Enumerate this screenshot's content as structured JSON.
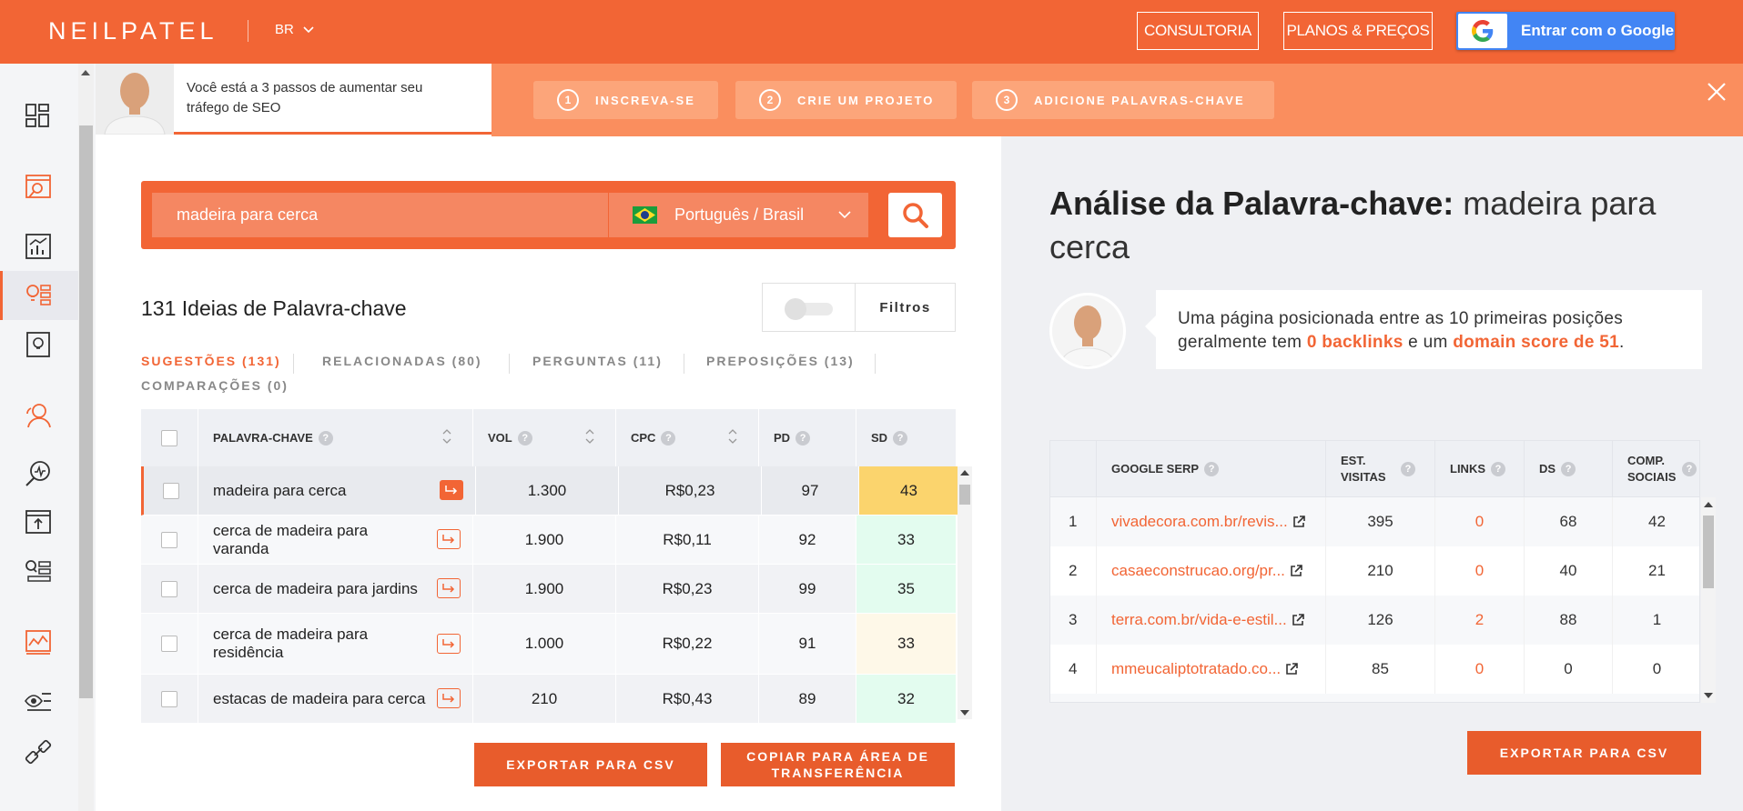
{
  "topbar": {
    "logo": "NEILPATEL",
    "lang": "BR",
    "consult_label": "CONSULTORIA",
    "planos_label": "PLANOS & PREÇOS",
    "google_label": "Entrar com o Google"
  },
  "banner": {
    "text": "Você está a 3 passos de aumentar seu tráfego de SEO",
    "steps": [
      {
        "num": "1",
        "label": "INSCREVA-SE"
      },
      {
        "num": "2",
        "label": "CRIE UM PROJETO"
      },
      {
        "num": "3",
        "label": "ADICIONE PALAVRAS-CHAVE"
      }
    ]
  },
  "search": {
    "value": "madeira para cerca",
    "language": "Português / Brasil"
  },
  "ideas": {
    "title": "131 Ideias de Palavra-chave",
    "filter_label": "Filtros",
    "tabs": [
      "SUGESTÕES (131)",
      "RELACIONADAS (80)",
      "PERGUNTAS (11)",
      "PREPOSIÇÕES (13)",
      "COMPARAÇÕES (0)"
    ],
    "columns": {
      "keyword": "PALAVRA-CHAVE",
      "vol": "VOL",
      "cpc": "CPC",
      "pd": "PD",
      "sd": "SD"
    },
    "rows": [
      {
        "keyword": "madeira para cerca",
        "vol": "1.300",
        "cpc": "R$0,23",
        "pd": "97",
        "sd": "43"
      },
      {
        "keyword": "cerca de madeira para varanda",
        "vol": "1.900",
        "cpc": "R$0,11",
        "pd": "92",
        "sd": "33"
      },
      {
        "keyword": "cerca de madeira para jardins",
        "vol": "1.900",
        "cpc": "R$0,23",
        "pd": "99",
        "sd": "35"
      },
      {
        "keyword": "cerca de madeira para residência",
        "vol": "1.000",
        "cpc": "R$0,22",
        "pd": "91",
        "sd": "33"
      },
      {
        "keyword": "estacas de madeira para cerca",
        "vol": "210",
        "cpc": "R$0,43",
        "pd": "89",
        "sd": "32"
      }
    ],
    "sd_colors": [
      "#fbd46d",
      "#e3fcef",
      "#e3fcef",
      "#fef8e8",
      "#e3fcef"
    ],
    "export_label": "EXPORTAR PARA CSV",
    "copy_label": "COPIAR PARA ÁREA DE TRANSFERÊNCIA"
  },
  "analysis": {
    "title_bold": "Análise da Palavra-chave:",
    "title_keyword": "madeira para cerca",
    "speech_1": "Uma página posicionada entre as 10 primeiras posições geralmente tem",
    "backlinks": "0 backlinks",
    "speech_2": "e um",
    "domain_score": "domain score de 51",
    "speech_3": "."
  },
  "serp": {
    "columns": {
      "serp": "GOOGLE SERP",
      "visits": "EST. VISITAS",
      "links": "LINKS",
      "ds": "DS",
      "social": "COMP. SOCIAIS"
    },
    "rows": [
      {
        "pos": "1",
        "url": "vivadecora.com.br/revis...",
        "visits": "395",
        "links": "0",
        "ds": "68",
        "social": "42"
      },
      {
        "pos": "2",
        "url": "casaeconstrucao.org/pr...",
        "visits": "210",
        "links": "0",
        "ds": "40",
        "social": "21"
      },
      {
        "pos": "3",
        "url": "terra.com.br/vida-e-estil...",
        "visits": "126",
        "links": "2",
        "ds": "88",
        "social": "1"
      },
      {
        "pos": "4",
        "url": "mmeucaliptotratado.co...",
        "visits": "85",
        "links": "0",
        "ds": "0",
        "social": "0"
      }
    ],
    "export_label": "EXPORTAR PARA CSV"
  },
  "colors": {
    "accent": "#f26535",
    "banner": "#fa8e5e",
    "step_bg": "#fca57a"
  }
}
